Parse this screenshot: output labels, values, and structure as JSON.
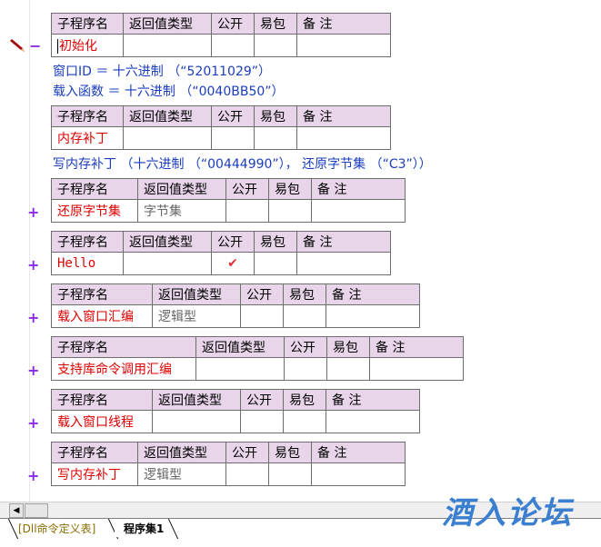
{
  "header_labels": {
    "name": "子程序名",
    "return_type": "返回值类型",
    "public": "公开",
    "easy_pack": "易包",
    "remark": "备 注"
  },
  "subroutines": [
    {
      "name": "初始化",
      "return_type": "",
      "public": "",
      "symbol": "−"
    },
    {
      "name": "内存补丁",
      "return_type": "",
      "public": "",
      "symbol": ""
    },
    {
      "name": "还原字节集",
      "return_type": "字节集",
      "public": "",
      "symbol": "+"
    },
    {
      "name": "Hello",
      "return_type": "",
      "public": "✔",
      "symbol": "+"
    },
    {
      "name": "载入窗口汇编",
      "return_type": "逻辑型",
      "public": "",
      "symbol": "+"
    },
    {
      "name": "支持库命令调用汇编",
      "return_type": "",
      "public": "",
      "symbol": "+"
    },
    {
      "name": "载入窗口线程",
      "return_type": "",
      "public": "",
      "symbol": "+"
    },
    {
      "name": "写内存补丁",
      "return_type": "逻辑型",
      "public": "",
      "symbol": "+"
    }
  ],
  "code_lines": [
    "窗口ID ＝ 十六进制 （“52011029”）",
    "载入函数 ＝ 十六进制 （“0040BB50”）",
    "写内存补丁 （十六进制 （“00444990”）， 还原字节集 （“C3”））"
  ],
  "tabs": [
    {
      "label": "[Dll命令定义表]"
    },
    {
      "label": "程序集1"
    }
  ],
  "watermark": "酒入论坛",
  "colors": {
    "header_bg": "#e8d5ea",
    "sub_name": "#e00000",
    "code_text": "#1a3dbf",
    "expand_symbol": "#8a2be2"
  }
}
